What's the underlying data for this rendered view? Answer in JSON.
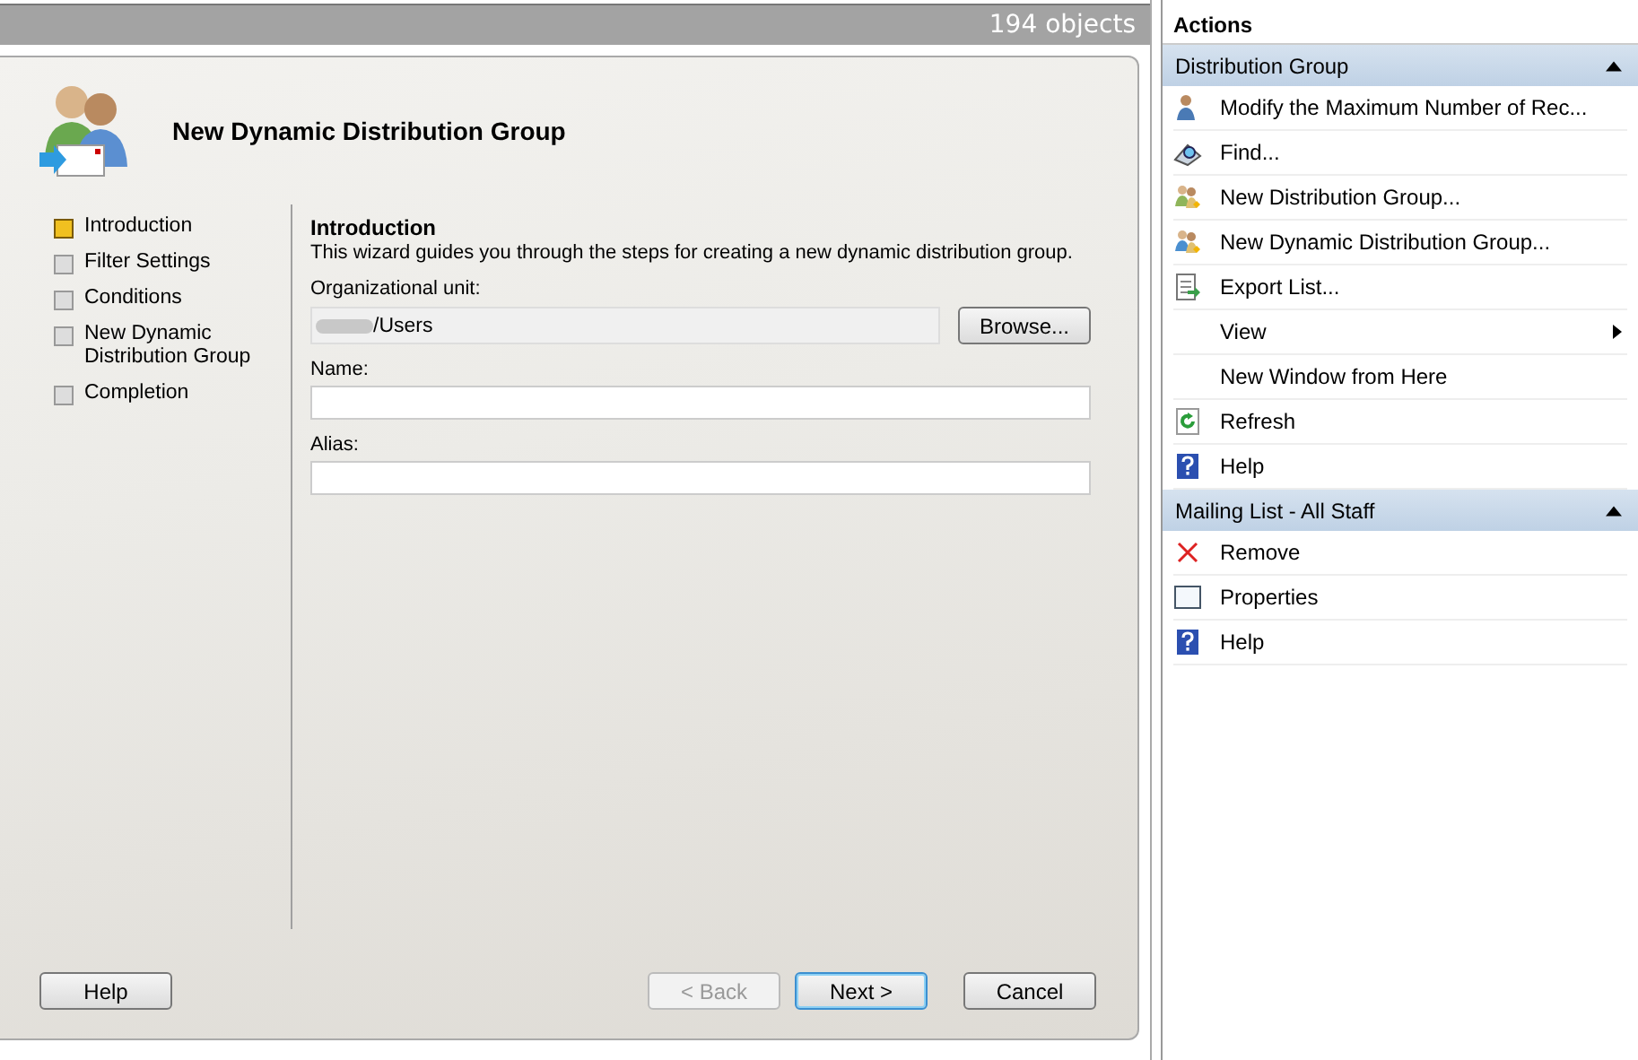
{
  "list_view": {
    "object_count": "194 objects"
  },
  "wizard": {
    "title": "New Dynamic Distribution Group",
    "steps": [
      {
        "label": "Introduction",
        "selected": true
      },
      {
        "label": "Filter Settings",
        "selected": false
      },
      {
        "label": "Conditions",
        "selected": false
      },
      {
        "label": "New Dynamic Distribution Group",
        "selected": false
      },
      {
        "label": "Completion",
        "selected": false
      }
    ],
    "page_title": "Introduction",
    "description": "This wizard guides you through the steps for creating a new dynamic distribution group.",
    "org_unit": {
      "label": "Organizational unit:",
      "value": "/Users",
      "browse": "Browse..."
    },
    "fields": [
      {
        "label": "Name:"
      },
      {
        "label": "Alias:"
      }
    ],
    "buttons": {
      "help": "Help",
      "back": {
        "label": "< Back",
        "disabled": true
      },
      "next": "Next >",
      "cancel": "Cancel"
    }
  },
  "actions": {
    "title": "Actions",
    "sections": [
      {
        "title": "Distribution Group",
        "expanded": true,
        "items": [
          {
            "label": "Modify the Maximum Number of Rec..."
          },
          {
            "label": "Find..."
          },
          {
            "label": "New Distribution Group..."
          },
          {
            "label": "New Dynamic Distribution Group..."
          },
          {
            "label": "Export List..."
          },
          {
            "label": "View",
            "submenu": true
          },
          {
            "label": "New Window from Here"
          },
          {
            "label": "Refresh"
          },
          {
            "label": "Help"
          }
        ]
      },
      {
        "title": "Mailing List - All Staff",
        "expanded": true,
        "items": [
          {
            "label": "Remove"
          },
          {
            "label": "Properties"
          },
          {
            "label": "Help"
          }
        ]
      }
    ]
  }
}
